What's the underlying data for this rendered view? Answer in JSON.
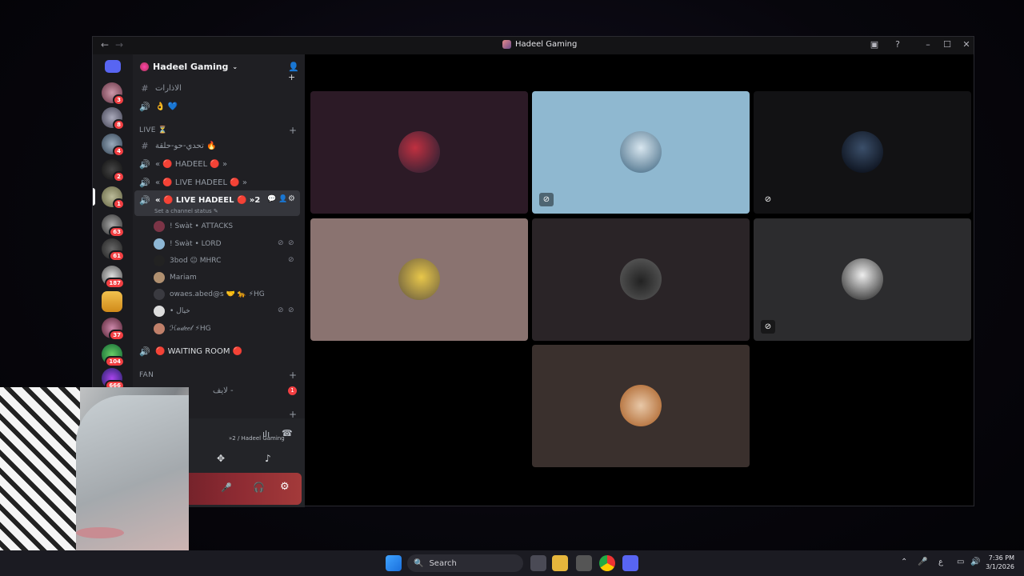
{
  "window": {
    "title": "Hadeel Gaming",
    "back": "←",
    "forward": "→"
  },
  "server": {
    "name": "Hadeel Gaming"
  },
  "server_badges": [
    "3",
    "8",
    "4",
    "2",
    "1",
    "63",
    "61",
    "187",
    "37",
    "104",
    "666"
  ],
  "channels": {
    "top1": "الاذارات",
    "top2": "👌 💙",
    "category_live": "LIVE ⏳",
    "ch_challenge": "تحدي-حو-حلقة 🔥",
    "ch_hadeel": "« 🔴 HADEEL 🔴 »",
    "ch_live1": "« 🔴 LIVE HADEEL 🔴 »",
    "ch_live2": "« 🔴 LIVE HADEEL 🔴 »2",
    "status": "Set a channel status ✎",
    "waiting": "🔴 WAITING ROOM 🔴",
    "category_fan": "FAN",
    "fan_ch": "لايف -",
    "fan_badge": "1"
  },
  "voice_users": [
    "! Swàt • ATTACKS",
    "! Swàt • LORD",
    "3bod 😐 MHRC",
    "Mariam",
    "owaes.abed@s 🤝 🐆 ⚡HG",
    "• خيال",
    "ℋ𝒶𝒹𝑒𝑒𝓁 ⚡HG"
  ],
  "voice_panel": {
    "connected": "»2 / Hadeel Gaming"
  },
  "taskbar": {
    "search": "Search",
    "time": "7:36 PM",
    "date": "3/1/2026",
    "lang": "ع"
  },
  "colors": {
    "accent_red": "#e0303f",
    "bg": "#000000"
  }
}
